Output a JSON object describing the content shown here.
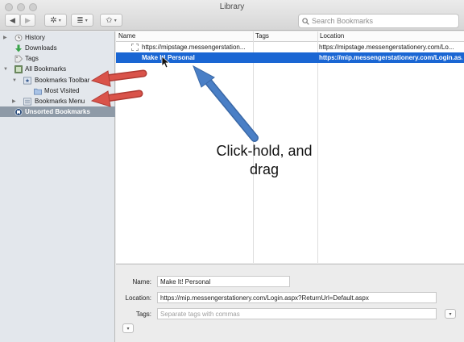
{
  "window": {
    "title": "Library"
  },
  "toolbar": {
    "back_glyph": "◀",
    "forward_glyph": "▶",
    "organize_glyph": "✲",
    "views_glyph": "≣",
    "import_glyph": "✩",
    "dropdown_glyph": "▾",
    "search_placeholder": "Search Bookmarks"
  },
  "sidebar": {
    "items": [
      {
        "label": "History",
        "icon": "clock-icon"
      },
      {
        "label": "Downloads",
        "icon": "download-arrow-icon"
      },
      {
        "label": "Tags",
        "icon": "tag-icon"
      },
      {
        "label": "All Bookmarks",
        "icon": "bookmarks-library-icon"
      },
      {
        "label": "Bookmarks Toolbar",
        "icon": "toolbar-folder-icon"
      },
      {
        "label": "Most Visited",
        "icon": "folder-icon"
      },
      {
        "label": "Bookmarks Menu",
        "icon": "menu-folder-icon"
      },
      {
        "label": "Unsorted Bookmarks",
        "icon": "unsorted-bookmarks-icon",
        "selected": true
      }
    ]
  },
  "list": {
    "columns": {
      "name": "Name",
      "tags": "Tags",
      "location": "Location"
    },
    "rows": [
      {
        "name": "https://mipstage.messengerstation...",
        "tags": "",
        "location": "https://mipstage.messengerstationery.com/Lo..."
      },
      {
        "name": "Make It! Personal",
        "tags": "",
        "location": "https://mip.messengerstationery.com/Login.as...",
        "selected": true
      }
    ]
  },
  "annotation": {
    "line1": "Click-hold, and",
    "line2": "drag"
  },
  "details": {
    "name_label": "Name:",
    "name_value": "Make It! Personal",
    "location_label": "Location:",
    "location_value": "https://mip.messengerstationery.com/Login.aspx?ReturnUrl=Default.aspx",
    "tags_label": "Tags:",
    "tags_placeholder": "Separate tags with commas"
  },
  "colors": {
    "selection_blue": "#1a66d3",
    "sidebar_selection": "#8e9aa7",
    "red_arrow": "#d9534a",
    "blue_arrow": "#4a7fc6"
  }
}
